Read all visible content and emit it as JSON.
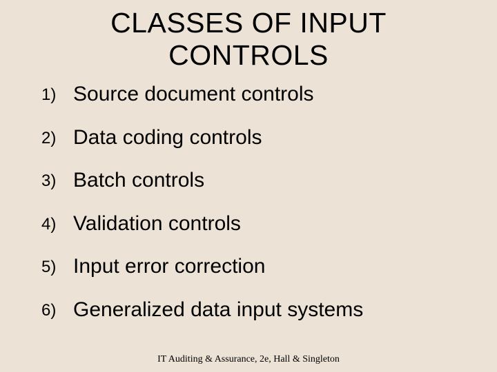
{
  "title": "CLASSES OF INPUT CONTROLS",
  "items": [
    "Source document controls",
    "Data coding controls",
    "Batch controls",
    "Validation controls",
    "Input error correction",
    "Generalized data input systems"
  ],
  "footer": "IT Auditing & Assurance, 2e, Hall & Singleton"
}
